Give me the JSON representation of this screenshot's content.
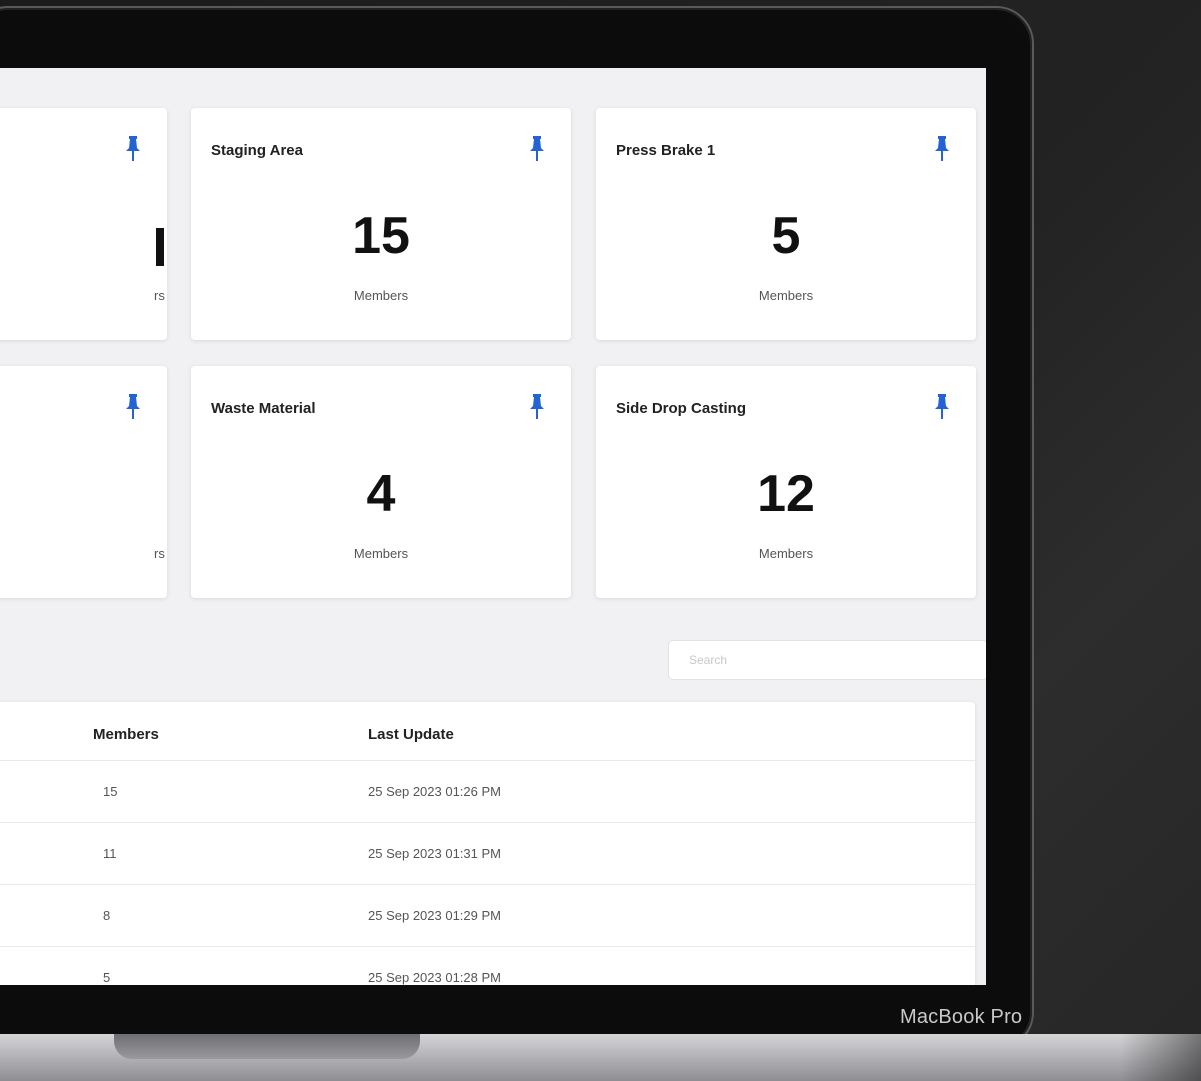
{
  "device_label": "MacBook Pro",
  "colors": {
    "accent": "#2463d6",
    "screen_bg": "#f1f1f3",
    "card_bg": "#ffffff"
  },
  "cards": [
    {
      "title": "",
      "count": "",
      "caption": "rs"
    },
    {
      "title": "Staging Area",
      "count": "15",
      "caption": "Members"
    },
    {
      "title": "Press Brake 1",
      "count": "5",
      "caption": "Members"
    },
    {
      "title": "",
      "count": "",
      "caption": "rs"
    },
    {
      "title": "Waste Material",
      "count": "4",
      "caption": "Members"
    },
    {
      "title": "Side Drop Casting",
      "count": "12",
      "caption": "Members"
    }
  ],
  "pin_icon": "pin-icon",
  "search": {
    "placeholder": "Search",
    "value": ""
  },
  "table": {
    "headers": {
      "members": "Members",
      "last_update": "Last Update"
    },
    "rows": [
      {
        "members": "15",
        "last_update": "25 Sep 2023 01:26 PM"
      },
      {
        "members": "11",
        "last_update": "25 Sep 2023 01:31 PM"
      },
      {
        "members": "8",
        "last_update": "25 Sep 2023 01:29 PM"
      },
      {
        "members": "5",
        "last_update": "25 Sep 2023 01:28 PM"
      }
    ]
  }
}
